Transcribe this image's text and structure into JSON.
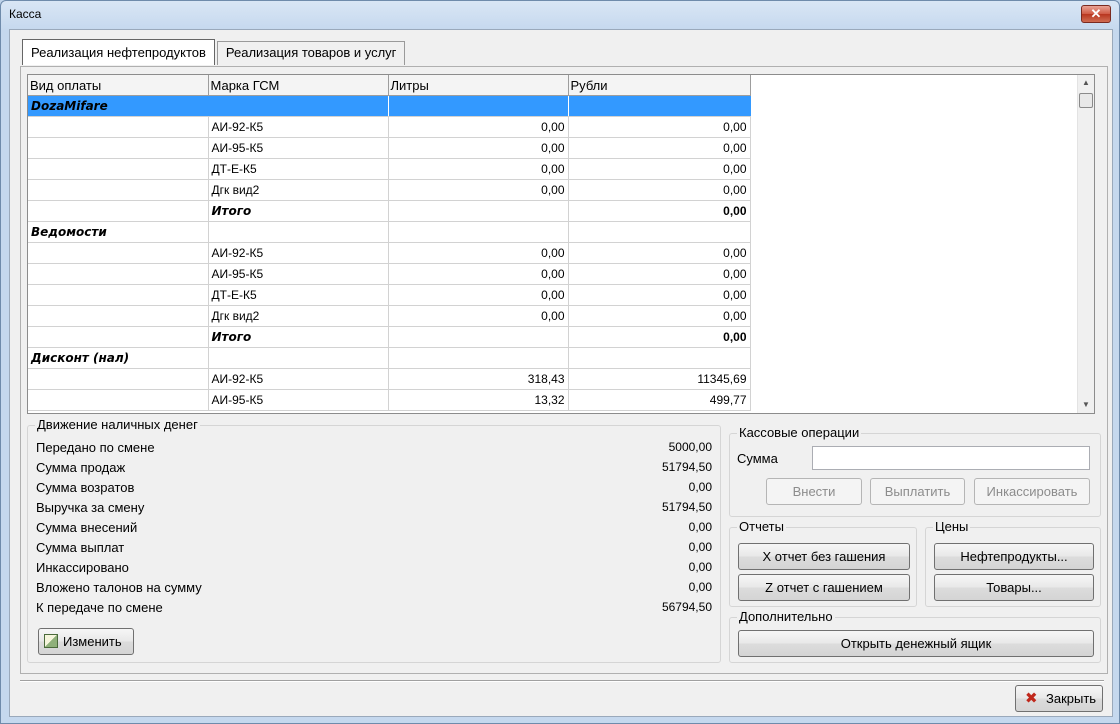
{
  "window": {
    "title": "Касса",
    "close_glyph": "✕"
  },
  "tabs": [
    "Реализация нефтепродуктов",
    "Реализация товаров и услуг"
  ],
  "grid": {
    "columns": [
      "Вид оплаты",
      "Марка ГСМ",
      "Литры",
      "Рубли"
    ],
    "rows": [
      {
        "type": "group",
        "cells": [
          "DozaMifare",
          "",
          "",
          ""
        ],
        "selected": true
      },
      {
        "type": "item",
        "cells": [
          "",
          "АИ-92-К5",
          "0,00",
          "0,00"
        ]
      },
      {
        "type": "item",
        "cells": [
          "",
          "АИ-95-К5",
          "0,00",
          "0,00"
        ]
      },
      {
        "type": "item",
        "cells": [
          "",
          "ДТ-Е-К5",
          "0,00",
          "0,00"
        ]
      },
      {
        "type": "item",
        "cells": [
          "",
          "Дгк вид2",
          "0,00",
          "0,00"
        ]
      },
      {
        "type": "total",
        "cells": [
          "",
          "Итого",
          "",
          "0,00"
        ]
      },
      {
        "type": "group",
        "cells": [
          "Ведомости",
          "",
          "",
          ""
        ]
      },
      {
        "type": "item",
        "cells": [
          "",
          "АИ-92-К5",
          "0,00",
          "0,00"
        ]
      },
      {
        "type": "item",
        "cells": [
          "",
          "АИ-95-К5",
          "0,00",
          "0,00"
        ]
      },
      {
        "type": "item",
        "cells": [
          "",
          "ДТ-Е-К5",
          "0,00",
          "0,00"
        ]
      },
      {
        "type": "item",
        "cells": [
          "",
          "Дгк вид2",
          "0,00",
          "0,00"
        ]
      },
      {
        "type": "total",
        "cells": [
          "",
          "Итого",
          "",
          "0,00"
        ]
      },
      {
        "type": "group",
        "cells": [
          "Дисконт  (нал)",
          "",
          "",
          ""
        ]
      },
      {
        "type": "item",
        "cells": [
          "",
          "АИ-92-К5",
          "318,43",
          "11345,69"
        ]
      },
      {
        "type": "item",
        "cells": [
          "",
          "АИ-95-К5",
          "13,32",
          "499,77"
        ]
      }
    ]
  },
  "cash": {
    "title": "Движение наличных денег",
    "rows": [
      {
        "label": "Передано по смене",
        "value": "5000,00"
      },
      {
        "label": "Сумма продаж",
        "value": "51794,50"
      },
      {
        "label": "Сумма возратов",
        "value": "0,00"
      },
      {
        "label": "Выручка за смену",
        "value": "51794,50"
      },
      {
        "label": "Сумма внесений",
        "value": "0,00"
      },
      {
        "label": "Сумма выплат",
        "value": "0,00"
      },
      {
        "label": "Инкассировано",
        "value": "0,00"
      },
      {
        "label": "Вложено талонов на сумму",
        "value": "0,00"
      },
      {
        "label": "К передаче по смене",
        "value": "56794,50"
      }
    ],
    "edit_button": "Изменить"
  },
  "cash_ops": {
    "title": "Кассовые операции",
    "amount_label": "Сумма",
    "amount_value": "",
    "deposit": "Внести",
    "payout": "Выплатить",
    "collect": "Инкассировать"
  },
  "reports": {
    "title": "Отчеты",
    "x_report": "X отчет без гашения",
    "z_report": "Z отчет с гашением"
  },
  "prices": {
    "title": "Цены",
    "fuel": "Нефтепродукты...",
    "goods": "Товары..."
  },
  "extra": {
    "title": "Дополнительно",
    "open_drawer": "Открыть денежный ящик"
  },
  "footer": {
    "close_button": "Закрыть",
    "close_glyph": "✖"
  },
  "colors": {
    "selection": "#3399ff",
    "close_icon": "#c0281c"
  }
}
